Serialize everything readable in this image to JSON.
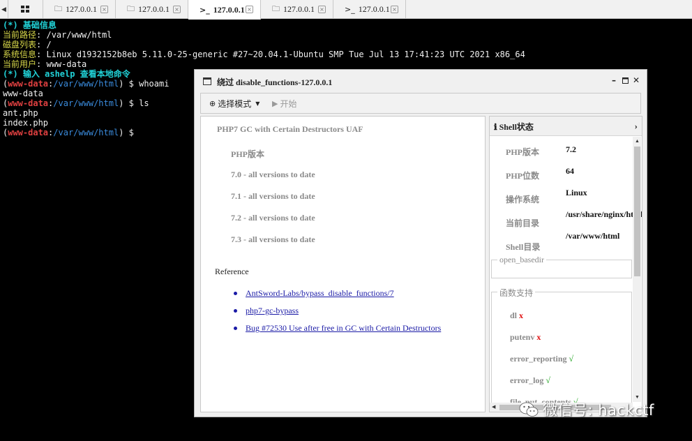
{
  "tabs": [
    {
      "label": "127.0.0.1",
      "icon": "folder-icon",
      "active": false
    },
    {
      "label": "127.0.0.1",
      "icon": "folder-icon",
      "active": false
    },
    {
      "label": "127.0.0.1",
      "icon": "terminal-icon",
      "active": true
    },
    {
      "label": "127.0.0.1",
      "icon": "folder-icon",
      "active": false
    },
    {
      "label": "127.0.0.1",
      "icon": "terminal-icon",
      "active": false
    }
  ],
  "terminal": {
    "basic_info_label": "(*) 基础信息",
    "cwd_label": "当前路径",
    "cwd_value": "/var/www/html",
    "disk_label": "磁盘列表",
    "disk_value": "/",
    "system_label": "系统信息",
    "system_value": "Linux d1932152b8eb 5.11.0-25-generic #27~20.04.1-Ubuntu SMP Tue Jul 13 17:41:23 UTC 2021 x86_64",
    "user_label": "当前用户",
    "user_value": "www-data",
    "help_line": "(*) 输入 ashelp 查看本地命令",
    "prompt_user": "www-data",
    "prompt_path": "/var/www/html",
    "cmd1": "whoami",
    "out1": "www-data",
    "cmd2": "ls",
    "out2a": "ant.php",
    "out2b": "index.php"
  },
  "dialog": {
    "title": "绕过 disable_functions-127.0.0.1",
    "toolbar": {
      "mode_label": "选择模式",
      "start_label": "开始"
    },
    "info": {
      "heading": "PHP7 GC with Certain Destructors UAF",
      "php_version_label": "PHP版本",
      "versions": [
        "7.0 - all versions to date",
        "7.1 - all versions to date",
        "7.2 - all versions to date",
        "7.3 - all versions to date"
      ],
      "reference_label": "Reference",
      "links": [
        "AntSword-Labs/bypass_disable_functions/7",
        "php7-gc-bypass",
        "Bug #72530 Use after free in GC with Certain Destructors"
      ]
    },
    "status": {
      "title": "Shell状态",
      "rows": [
        {
          "label": "PHP版本",
          "value": "7.2"
        },
        {
          "label": "PHP位数",
          "value": "64"
        },
        {
          "label": "操作系统",
          "value": "Linux"
        },
        {
          "label": "当前目录",
          "value": "/usr/share/nginx/html"
        },
        {
          "label": "Shell目录",
          "value": "/var/www/html"
        }
      ],
      "open_basedir_label": "open_basedir",
      "functions_label": "函数支持",
      "functions": [
        {
          "name": "dl",
          "mark": "x"
        },
        {
          "name": "putenv",
          "mark": "x"
        },
        {
          "name": "error_reporting",
          "mark": "√"
        },
        {
          "name": "error_log",
          "mark": "√"
        },
        {
          "name": "file_put_contents",
          "mark": "√"
        }
      ]
    }
  },
  "watermark": {
    "text": "微信号: hackctf"
  },
  "colors": {
    "cyan": "#21d3d8",
    "yellow": "#d8d84a",
    "red": "#e04040",
    "path": "#3a8bdc",
    "link": "#1a1aa6",
    "ok": "#18a018"
  }
}
